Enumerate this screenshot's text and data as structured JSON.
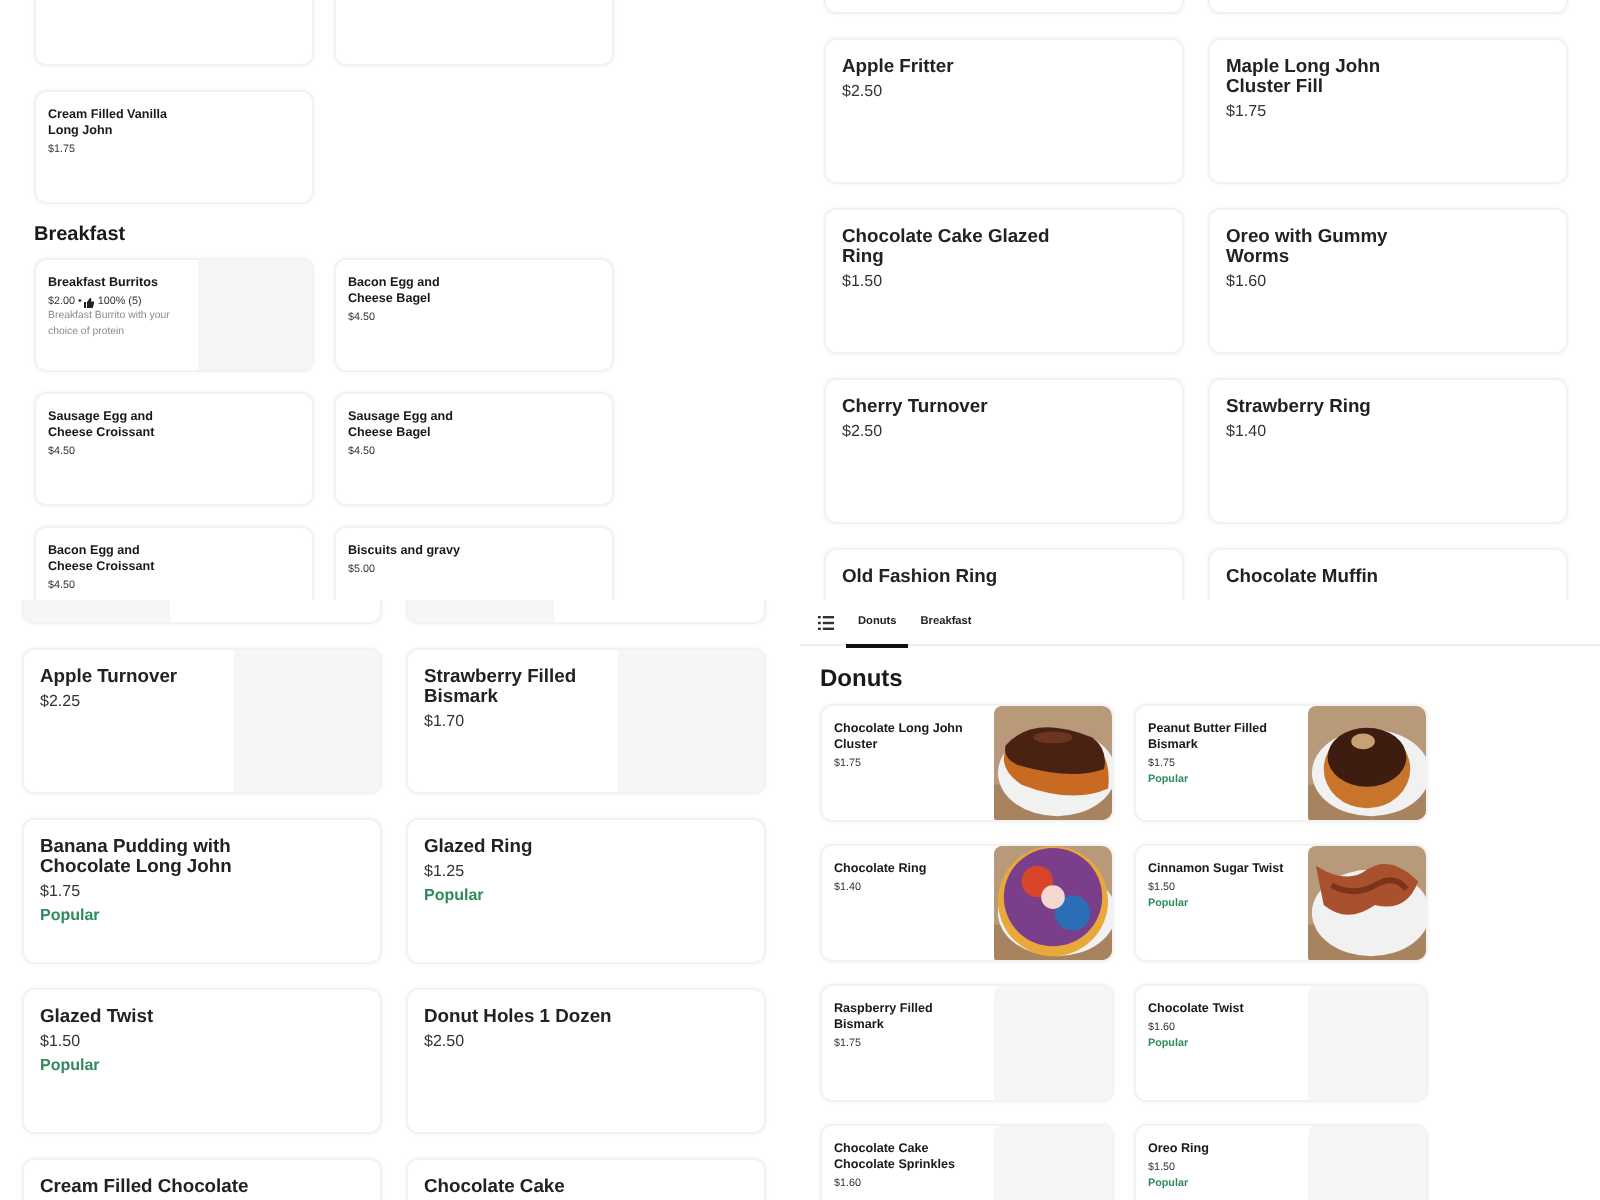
{
  "panels": [
    {
      "kind": "compact",
      "sections": [
        {
          "items": [
            {
              "kind": "clipped"
            },
            {
              "kind": "clipped"
            },
            {
              "name": "Cream Filled Vanilla Long John",
              "price": "$1.75"
            }
          ]
        },
        {
          "heading": "Breakfast",
          "items": [
            {
              "name": "Breakfast Burritos",
              "price": "$2.00",
              "separator": "•",
              "rating": "100% (5)",
              "description": "Breakfast Burrito with your choice of protein",
              "has_image": true
            },
            {
              "name": "Bacon Egg and Cheese Bagel",
              "price": "$4.50"
            },
            {
              "name": "Sausage Egg and Cheese Croissant",
              "price": "$4.50"
            },
            {
              "name": "Sausage Egg and Cheese Bagel",
              "price": "$4.50"
            },
            {
              "name": "Bacon Egg and Cheese Croissant",
              "price": "$4.50"
            },
            {
              "name": "Biscuits and gravy",
              "price": "$5.00"
            }
          ]
        }
      ]
    },
    {
      "kind": "large",
      "sections": [
        {
          "items": [
            {
              "kind": "clipped"
            },
            {
              "kind": "clipped"
            },
            {
              "name": "Apple Fritter",
              "price": "$2.50"
            },
            {
              "name": "Maple Long John Cluster Fill",
              "price": "$1.75"
            },
            {
              "name": "Chocolate Cake Glazed Ring",
              "price": "$1.50"
            },
            {
              "name": "Oreo with Gummy Worms",
              "price": "$1.60"
            },
            {
              "name": "Cherry Turnover",
              "price": "$2.50"
            },
            {
              "name": "Strawberry Ring",
              "price": "$1.40"
            },
            {
              "name": "Old Fashion Ring"
            },
            {
              "name": "Chocolate Muffin"
            }
          ]
        }
      ]
    },
    {
      "kind": "large",
      "sections": [
        {
          "items": [
            {
              "kind": "clipped",
              "has_image": true
            },
            {
              "kind": "clipped",
              "has_image": true
            },
            {
              "name": "Apple Turnover",
              "price": "$2.25",
              "has_image": true
            },
            {
              "name": "Strawberry Filled Bismark",
              "price": "$1.70",
              "has_image": true
            },
            {
              "name": "Banana Pudding with Chocolate Long John",
              "price": "$1.75",
              "badge": "Popular"
            },
            {
              "name": "Glazed Ring",
              "price": "$1.25",
              "badge": "Popular"
            },
            {
              "name": "Glazed Twist",
              "price": "$1.50",
              "badge": "Popular"
            },
            {
              "name": "Donut Holes 1 Dozen",
              "price": "$2.50"
            },
            {
              "name": "Cream Filled Chocolate"
            },
            {
              "name": "Chocolate Cake"
            }
          ]
        }
      ]
    },
    {
      "kind": "compact",
      "tabs": [
        {
          "label": "Donuts",
          "selected": true
        },
        {
          "label": "Breakfast",
          "selected": false
        }
      ],
      "sections": [
        {
          "heading": "Donuts",
          "items": [
            {
              "kind": "picture",
              "name": "Chocolate Long John Cluster",
              "price": "$1.75"
            },
            {
              "kind": "picture",
              "name": "Peanut Butter Filled Bismark",
              "price": "$1.75",
              "badge": "Popular"
            },
            {
              "kind": "picture",
              "name": "Chocolate Ring",
              "price": "$1.40"
            },
            {
              "kind": "picture",
              "name": "Cinnamon Sugar Twist",
              "price": "$1.50",
              "badge": "Popular"
            },
            {
              "name": "Raspberry Filled Bismark",
              "price": "$1.75",
              "has_image": true
            },
            {
              "name": "Chocolate Twist",
              "price": "$1.60",
              "badge": "Popular",
              "has_image": true
            },
            {
              "name": "Chocolate Cake Chocolate Sprinkles",
              "price": "$1.60",
              "has_image": true
            },
            {
              "name": "Oreo Ring",
              "price": "$1.50",
              "badge": "Popular",
              "has_image": true
            }
          ]
        }
      ]
    }
  ]
}
